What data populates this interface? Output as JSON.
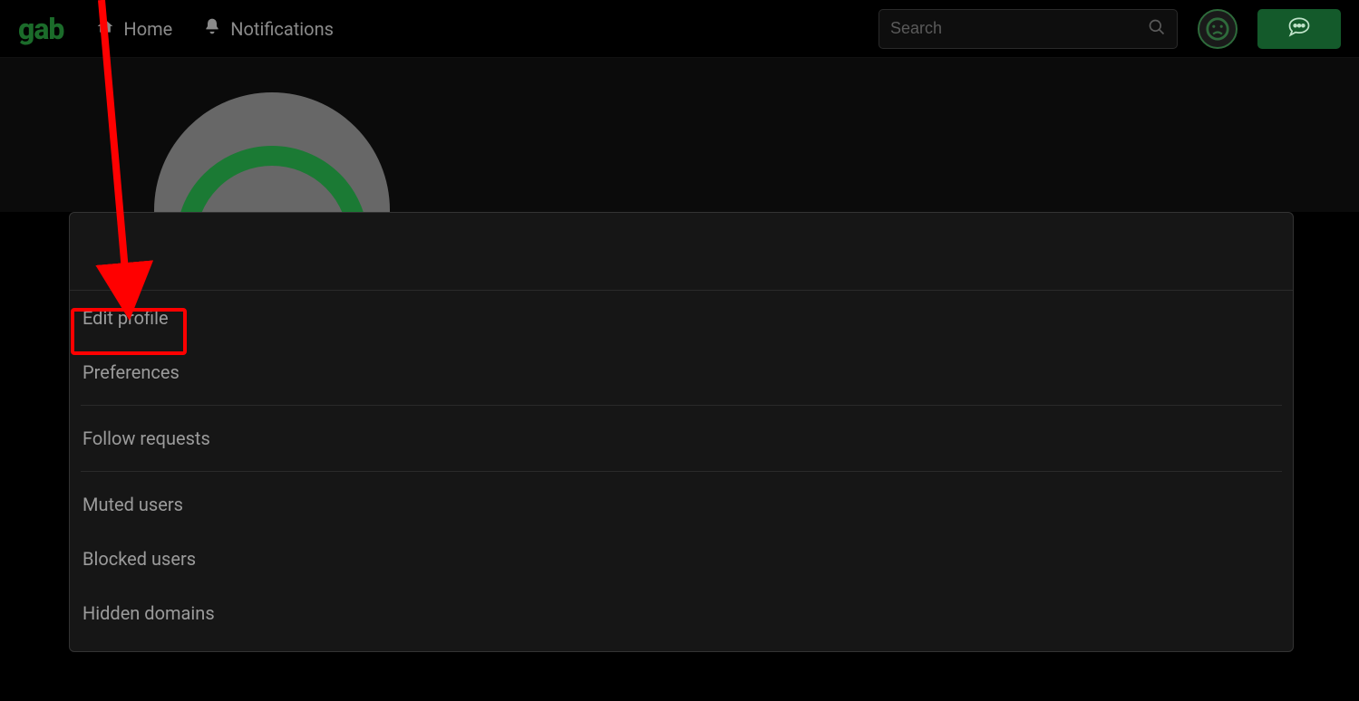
{
  "brand": {
    "name": "gab"
  },
  "nav": {
    "home_label": "Home",
    "notifications_label": "Notifications"
  },
  "search": {
    "placeholder": "Search"
  },
  "menu": {
    "items": [
      {
        "label": "Edit profile",
        "highlighted": true
      },
      {
        "label": "Preferences"
      },
      {
        "label": "Follow requests"
      },
      {
        "label": "Muted users"
      },
      {
        "label": "Blocked users"
      },
      {
        "label": "Hidden domains"
      }
    ]
  },
  "colors": {
    "accent_green": "#1b7a34",
    "highlight_red": "#ff0000"
  }
}
